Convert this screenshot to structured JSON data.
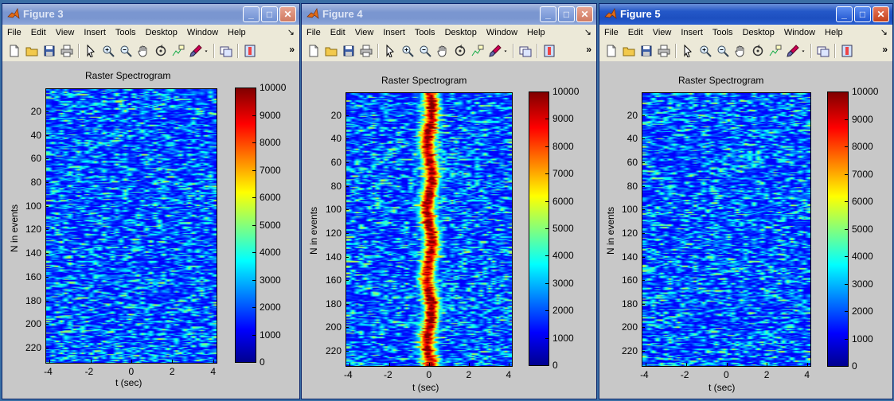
{
  "menu": [
    "File",
    "Edit",
    "View",
    "Insert",
    "Tools",
    "Desktop",
    "Window",
    "Help"
  ],
  "menu_more": "↘",
  "toolbar_more": "»",
  "toolbar_icons": [
    "new-file-icon",
    "open-folder-icon",
    "save-icon",
    "print-icon",
    "pointer-icon",
    "zoom-in-icon",
    "zoom-out-icon",
    "pan-hand-icon",
    "rotate-3d-icon",
    "data-cursor-icon",
    "brush-icon",
    "brush-dropdown-icon",
    "link-plot-icon",
    "colorbar-toggle-icon"
  ],
  "windows": [
    {
      "title": "Figure 3",
      "active": false,
      "chart_data": {
        "type": "heatmap",
        "title": "Raster Spectrogram",
        "xlabel": "t (sec)",
        "ylabel": "N in events",
        "xlim": [
          -4.2,
          4.2
        ],
        "ylim": [
          1,
          233
        ],
        "xticks": [
          "-4",
          "-2",
          "0",
          "2",
          "4"
        ],
        "yticks": [
          "20",
          "40",
          "60",
          "80",
          "100",
          "120",
          "140",
          "160",
          "180",
          "200",
          "220"
        ],
        "colorbar_ticks": [
          "10000",
          "9000",
          "8000",
          "7000",
          "6000",
          "5000",
          "4000",
          "3000",
          "2000",
          "1000",
          "0"
        ],
        "clim": [
          0,
          10000
        ],
        "colormap": "jet",
        "pattern": "uniform background noise (mostly blue) with no central response"
      }
    },
    {
      "title": "Figure 4",
      "active": false,
      "chart_data": {
        "type": "heatmap",
        "title": "Raster Spectrogram",
        "xlabel": "t (sec)",
        "ylabel": "N in events",
        "xlim": [
          -4.2,
          4.2
        ],
        "ylim": [
          1,
          233
        ],
        "xticks": [
          "-4",
          "-2",
          "0",
          "2",
          "4"
        ],
        "yticks": [
          "20",
          "40",
          "60",
          "80",
          "100",
          "120",
          "140",
          "160",
          "180",
          "200",
          "220"
        ],
        "colorbar_ticks": [
          "10000",
          "9000",
          "8000",
          "7000",
          "6000",
          "5000",
          "4000",
          "3000",
          "2000",
          "1000",
          "0"
        ],
        "clim": [
          0,
          10000
        ],
        "colormap": "jet",
        "pattern": "strong vertical band of high power centered at t = 0 sec (approx -0.6 to 0.6 sec)"
      }
    },
    {
      "title": "Figure 5",
      "active": true,
      "chart_data": {
        "type": "heatmap",
        "title": "Raster Spectrogram",
        "xlabel": "t (sec)",
        "ylabel": "N in events",
        "xlim": [
          -4.2,
          4.2
        ],
        "ylim": [
          1,
          233
        ],
        "xticks": [
          "-4",
          "-2",
          "0",
          "2",
          "4"
        ],
        "yticks": [
          "20",
          "40",
          "60",
          "80",
          "100",
          "120",
          "140",
          "160",
          "180",
          "200",
          "220"
        ],
        "colorbar_ticks": [
          "10000",
          "9000",
          "8000",
          "7000",
          "6000",
          "5000",
          "4000",
          "3000",
          "2000",
          "1000",
          "0"
        ],
        "clim": [
          0,
          10000
        ],
        "colormap": "jet",
        "pattern": "uniform background noise (mostly blue) with no central response"
      }
    }
  ]
}
